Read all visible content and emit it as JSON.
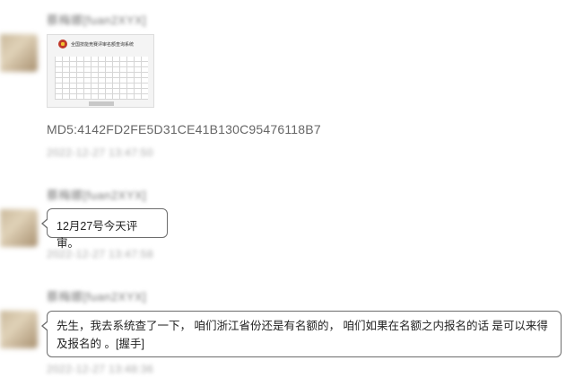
{
  "messages": [
    {
      "sender": "蔡梅娜[fuan2XYX]",
      "type": "image",
      "image_title": "全国技能竞赛评审名额查询系统",
      "caption": "MD5:4142FD2FE5D31CE41B130C95476118B7",
      "time": "2022-12-27 13:47:50"
    },
    {
      "sender": "蔡梅娜[fuan2XYX]",
      "type": "text",
      "text": "12月27号今天评审。",
      "time": "2022-12-27 13:47:58"
    },
    {
      "sender": "蔡梅娜[fuan2XYX]",
      "type": "text",
      "text": "先生，我去系统查了一下， 咱们浙江省份还是有名额的， 咱们如果在名额之内报名的话 是可以来得及报名的 。[握手]",
      "time": "2022-12-27 13:48:36"
    }
  ]
}
